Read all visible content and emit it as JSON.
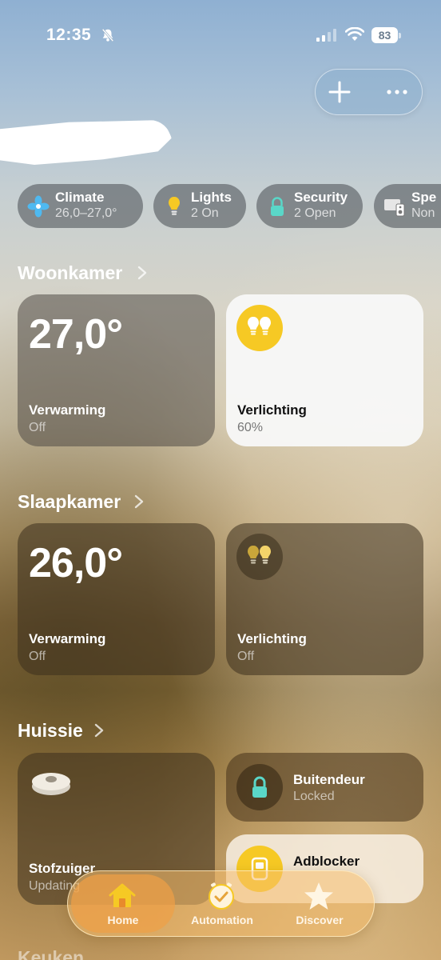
{
  "status_bar": {
    "time": "12:35",
    "battery": "83"
  },
  "chips": [
    {
      "title": "Climate",
      "subtitle": "26,0–27,0°",
      "icon": "fan-icon",
      "color": "#4fb9f0"
    },
    {
      "title": "Lights",
      "subtitle": "2 On",
      "icon": "lightbulb-icon",
      "color": "#f6c924"
    },
    {
      "title": "Security",
      "subtitle": "2 Open",
      "icon": "lock-icon",
      "color": "#5ad7c8"
    },
    {
      "title": "Spe",
      "subtitle": "Non",
      "icon": "speaker-icon",
      "color": "#e6e6e6"
    }
  ],
  "sections": [
    {
      "title": "Woonkamer",
      "tiles": [
        {
          "value": "27,0°",
          "name": "Verwarming",
          "status": "Off"
        },
        {
          "name": "Verlichting",
          "status": "60%",
          "icon": "lightbulbs-icon"
        }
      ]
    },
    {
      "title": "Slaapkamer",
      "tiles": [
        {
          "value": "26,0°",
          "name": "Verwarming",
          "status": "Off"
        },
        {
          "name": "Verlichting",
          "status": "Off",
          "icon": "lightbulbs-icon"
        }
      ]
    },
    {
      "title": "Huissie",
      "tiles": [
        {
          "name": "Stofzuiger",
          "status": "Updating",
          "icon": "robot-vacuum-icon"
        },
        {
          "name": "Buitendeur",
          "status": "Locked",
          "icon": "lock-icon"
        },
        {
          "name": "Adblocker",
          "status": "",
          "icon": "switch-icon"
        }
      ]
    }
  ],
  "partial_section": "Keuken",
  "tabbar": [
    {
      "label": "Home",
      "icon": "house-icon",
      "active": true
    },
    {
      "label": "Automation",
      "icon": "clock-check-icon",
      "active": false
    },
    {
      "label": "Discover",
      "icon": "star-icon",
      "active": false
    }
  ],
  "colors": {
    "accent_yellow": "#f6c924",
    "lock_teal": "#5ad7c8",
    "tab_orange": "#f0a046"
  }
}
